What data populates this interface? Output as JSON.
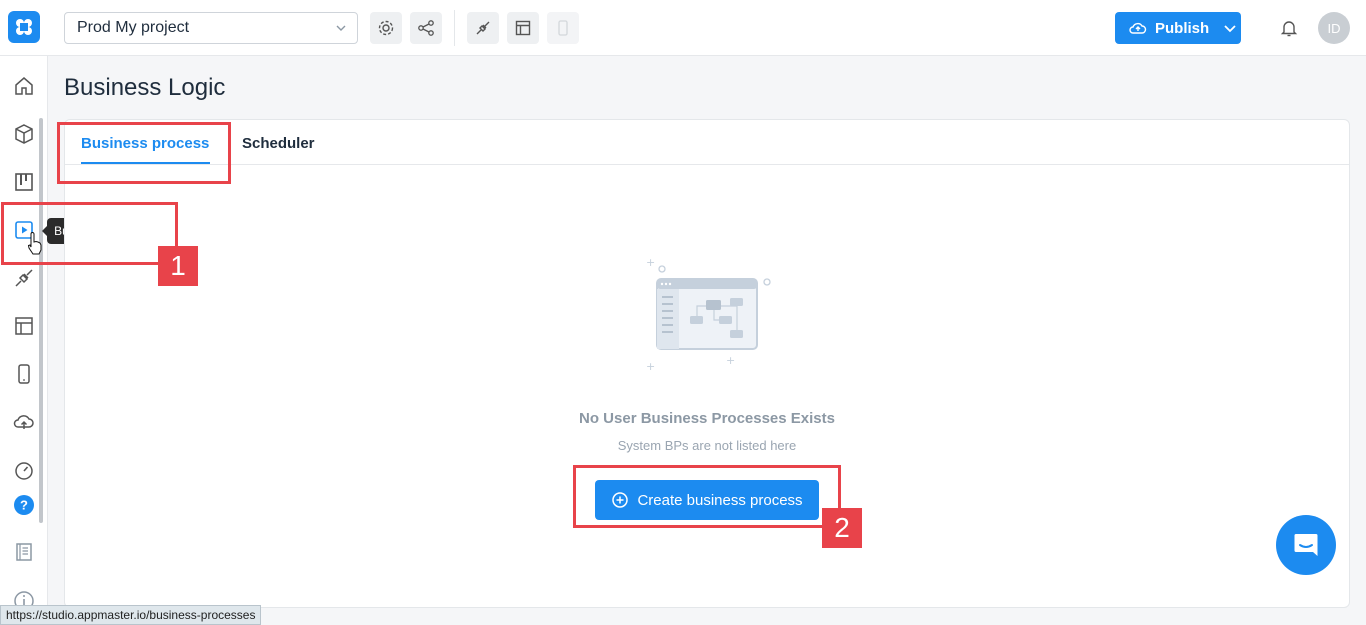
{
  "topbar": {
    "project_name": "Prod My project",
    "publish_label": "Publish",
    "avatar_initials": "ID"
  },
  "sidebar": {
    "tooltip": "Business logic",
    "items": [
      {
        "icon": "home-icon"
      },
      {
        "icon": "cube-icon"
      },
      {
        "icon": "kanban-icon"
      },
      {
        "icon": "play-square-icon"
      },
      {
        "icon": "plug-icon"
      },
      {
        "icon": "layout-icon"
      },
      {
        "icon": "mobile-icon"
      },
      {
        "icon": "cloud-upload-icon"
      },
      {
        "icon": "gauge-icon"
      },
      {
        "icon": "help-icon"
      },
      {
        "icon": "book-icon"
      },
      {
        "icon": "info-icon"
      }
    ]
  },
  "main": {
    "title": "Business Logic",
    "tabs": [
      {
        "label": "Business process",
        "active": true
      },
      {
        "label": "Scheduler",
        "active": false
      }
    ],
    "empty_state": {
      "title": "No User Business Processes Exists",
      "subtitle": "System BPs are not listed here",
      "button_label": "Create business process"
    }
  },
  "annotations": {
    "badge_1": "1",
    "badge_2": "2"
  },
  "status_bar": {
    "url": "https://studio.appmaster.io/business-processes"
  },
  "colors": {
    "accent": "#1c8bf0",
    "annotation": "#e8434a"
  }
}
